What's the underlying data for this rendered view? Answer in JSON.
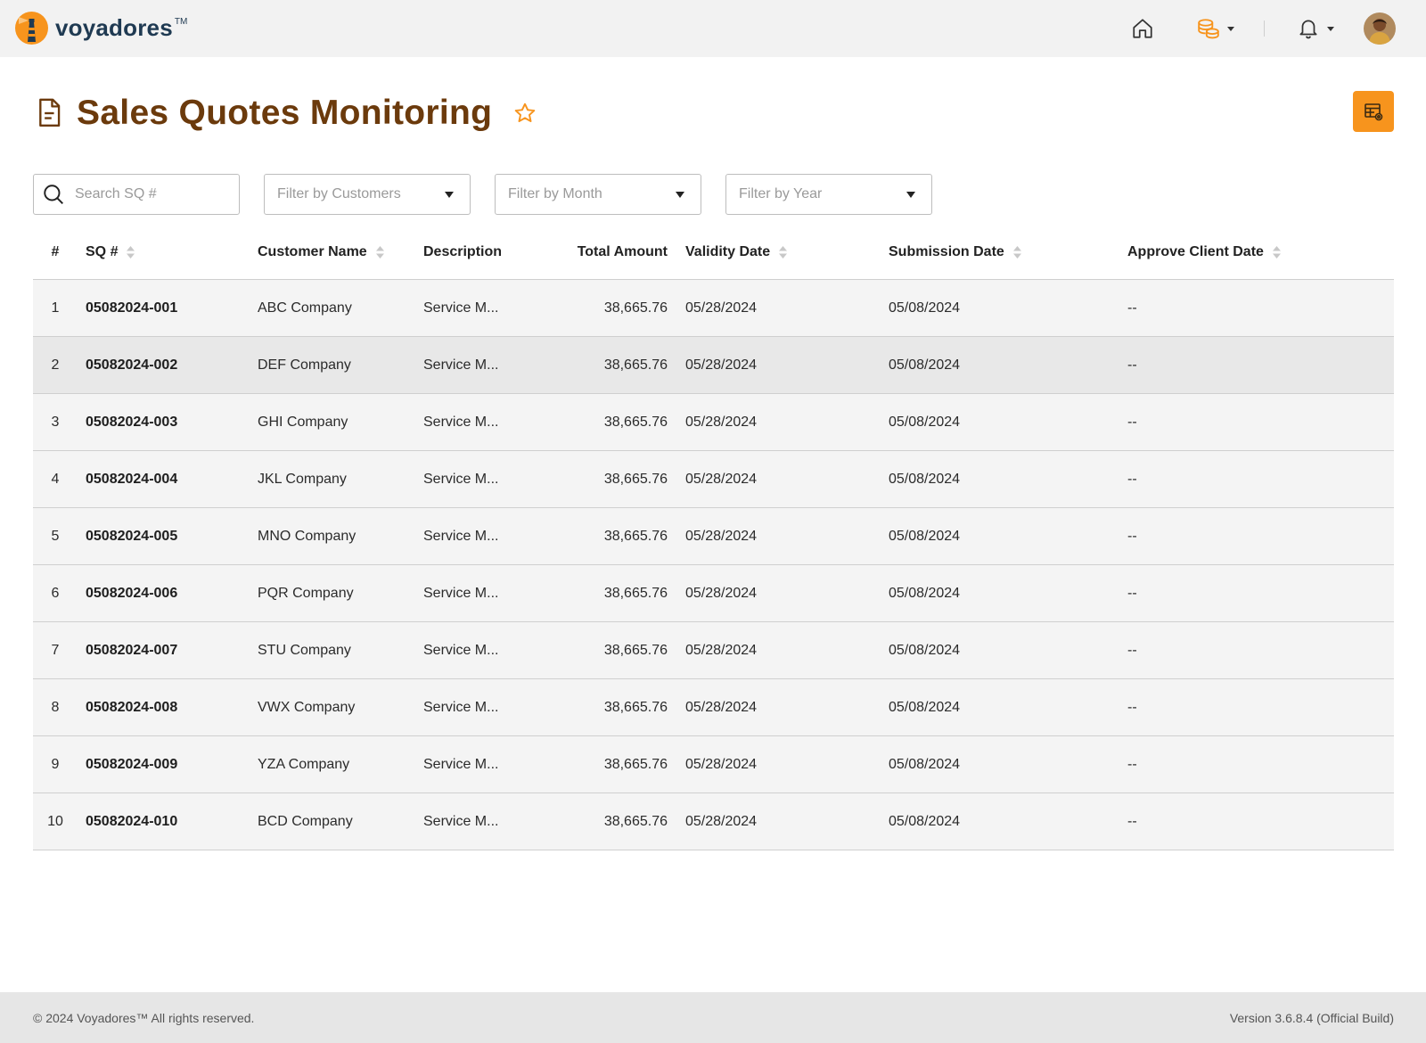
{
  "brand": {
    "name": "voyadores",
    "tm": "TM"
  },
  "nav": {
    "icons": [
      "home-icon",
      "coins-icon",
      "bell-icon"
    ],
    "accent": "#f7941d"
  },
  "header": {
    "title": "Sales Quotes Monitoring",
    "title_color": "#6b3a0c"
  },
  "filters": {
    "search_placeholder": "Search SQ #",
    "customers_placeholder": "Filter by Customers",
    "month_placeholder": "Filter by Month",
    "year_placeholder": "Filter by Year"
  },
  "table": {
    "columns": [
      "#",
      "SQ #",
      "Customer Name",
      "Description",
      "Total Amount",
      "Validity Date",
      "Submission Date",
      "Approve Client Date"
    ],
    "rows": [
      {
        "num": "1",
        "sq": "05082024-001",
        "customer": "ABC Company",
        "description": "Service M...",
        "amount": "38,665.76",
        "validity": "05/28/2024",
        "submission": "05/08/2024",
        "approve": "--"
      },
      {
        "num": "2",
        "sq": "05082024-002",
        "customer": "DEF Company",
        "description": "Service M...",
        "amount": "38,665.76",
        "validity": "05/28/2024",
        "submission": "05/08/2024",
        "approve": "--"
      },
      {
        "num": "3",
        "sq": "05082024-003",
        "customer": "GHI Company",
        "description": "Service M...",
        "amount": "38,665.76",
        "validity": "05/28/2024",
        "submission": "05/08/2024",
        "approve": "--"
      },
      {
        "num": "4",
        "sq": "05082024-004",
        "customer": "JKL Company",
        "description": "Service M...",
        "amount": "38,665.76",
        "validity": "05/28/2024",
        "submission": "05/08/2024",
        "approve": "--"
      },
      {
        "num": "5",
        "sq": "05082024-005",
        "customer": "MNO Company",
        "description": "Service M...",
        "amount": "38,665.76",
        "validity": "05/28/2024",
        "submission": "05/08/2024",
        "approve": "--"
      },
      {
        "num": "6",
        "sq": "05082024-006",
        "customer": "PQR Company",
        "description": "Service M...",
        "amount": "38,665.76",
        "validity": "05/28/2024",
        "submission": "05/08/2024",
        "approve": "--"
      },
      {
        "num": "7",
        "sq": "05082024-007",
        "customer": "STU Company",
        "description": "Service M...",
        "amount": "38,665.76",
        "validity": "05/28/2024",
        "submission": "05/08/2024",
        "approve": "--"
      },
      {
        "num": "8",
        "sq": "05082024-008",
        "customer": "VWX Company",
        "description": "Service M...",
        "amount": "38,665.76",
        "validity": "05/28/2024",
        "submission": "05/08/2024",
        "approve": "--"
      },
      {
        "num": "9",
        "sq": "05082024-009",
        "customer": "YZA Company",
        "description": "Service M...",
        "amount": "38,665.76",
        "validity": "05/28/2024",
        "submission": "05/08/2024",
        "approve": "--"
      },
      {
        "num": "10",
        "sq": "05082024-010",
        "customer": "BCD Company",
        "description": "Service M...",
        "amount": "38,665.76",
        "validity": "05/28/2024",
        "submission": "05/08/2024",
        "approve": "--"
      }
    ]
  },
  "footer": {
    "copyright": "© 2024 Voyadores™ All rights reserved.",
    "version": "Version 3.6.8.4 (Official Build)"
  }
}
